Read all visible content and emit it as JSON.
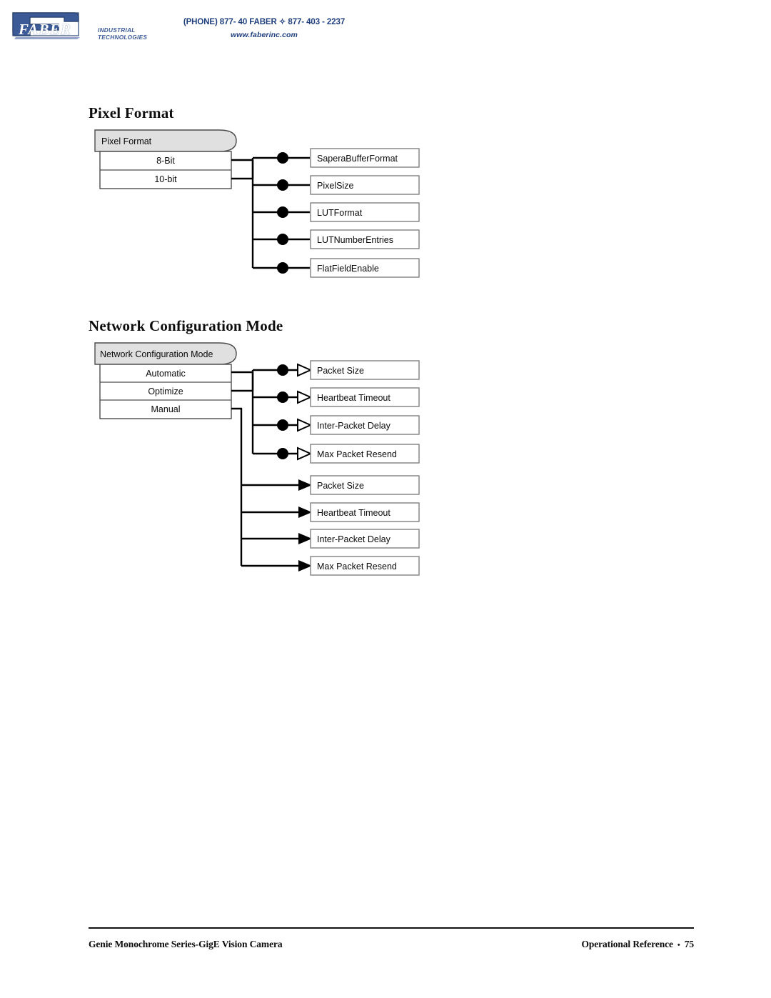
{
  "header": {
    "logo": {
      "wordmark": "FABER",
      "line1": "INDUSTRIAL",
      "line2": "TECHNOLOGIES",
      "brand_color": "#3c5a96"
    },
    "contact": {
      "phone": "(PHONE) 877- 40 FABER  ✧  877- 403 - 2237",
      "website": "www.faberinc.com",
      "text_color": "#20407e"
    }
  },
  "sections": [
    {
      "title": "Pixel Format",
      "header_node": "Pixel Format",
      "options": [
        "8-Bit",
        "10-bit"
      ],
      "features": [
        "SaperaBufferFormat",
        "PixelSize",
        "LUTFormat",
        "LUTNumberEntries",
        "FlatFieldEnable"
      ],
      "connector_style": "circle"
    },
    {
      "title": "Network Configuration Mode",
      "header_node": "Network Configuration Mode",
      "options": [
        "Automatic",
        "Optimize",
        "Manual"
      ],
      "features_upper": [
        "Packet Size",
        "Heartbeat Timeout",
        "Inter-Packet Delay",
        "Max Packet Resend"
      ],
      "features_lower": [
        "Packet Size",
        "Heartbeat Timeout",
        "Inter-Packet Delay",
        "Max Packet Resend"
      ],
      "connector_style_upper": "circle-hollow-arrow",
      "connector_style_lower": "filled-arrow"
    }
  ],
  "footer": {
    "left": "Genie Monochrome Series-GigE Vision Camera",
    "right_label": "Operational Reference",
    "bullet": "•",
    "page_number": "75"
  }
}
